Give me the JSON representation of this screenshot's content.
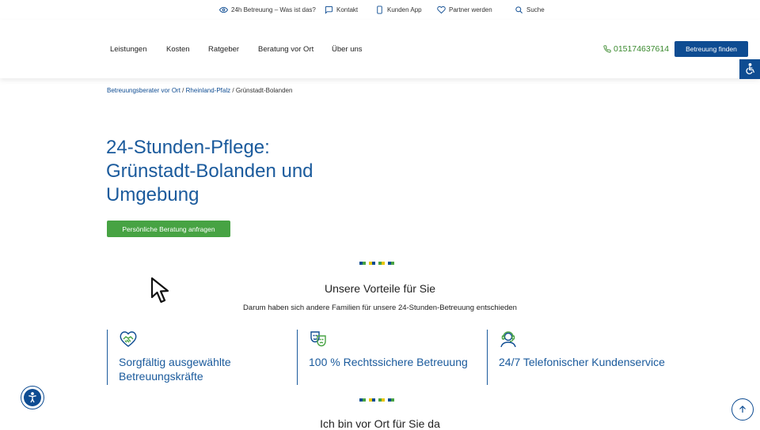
{
  "topbar": {
    "what_is": "24h Betreuung – Was ist das?",
    "contact": "Kontakt",
    "app": "Kunden App",
    "partner": "Partner werden",
    "search": "Suche"
  },
  "nav": {
    "items": [
      "Leistungen",
      "Kosten",
      "Ratgeber",
      "Beratung vor Ort",
      "Über uns"
    ],
    "phone": "015174637614",
    "cta": "Betreuung finden"
  },
  "breadcrumb": {
    "items": [
      "Betreuungsberater vor Ort",
      "Rheinland-Pfalz",
      "Grünstadt-Bolanden"
    ],
    "separator": "/"
  },
  "hero": {
    "title": "24-Stunden-Pflege: Grünstadt-Bolanden und Umgebung",
    "button": "Persönliche Beratung anfragen"
  },
  "advantages": {
    "title": "Unsere Vorteile für Sie",
    "subtitle": "Darum haben sich andere Familien für unsere 24-Stunden-Betreuung entschieden",
    "features": [
      {
        "icon": "handshake-heart-icon",
        "text": "Sorgfältig ausgewählte Betreuungskräfte"
      },
      {
        "icon": "theater-masks-icon",
        "text": "100 % Rechtssichere Betreuung"
      },
      {
        "icon": "headset-agent-icon",
        "text": "24/7 Telefonischer Kundenservice"
      }
    ]
  },
  "next_section": {
    "title": "Ich bin vor Ort für Sie da"
  },
  "colors": {
    "brand_blue": "#0e4c92",
    "heading_blue": "#1a5a9c",
    "brand_green": "#47a343",
    "phone_green": "#3b8a2f",
    "deco_yellow": "#e8c600"
  }
}
